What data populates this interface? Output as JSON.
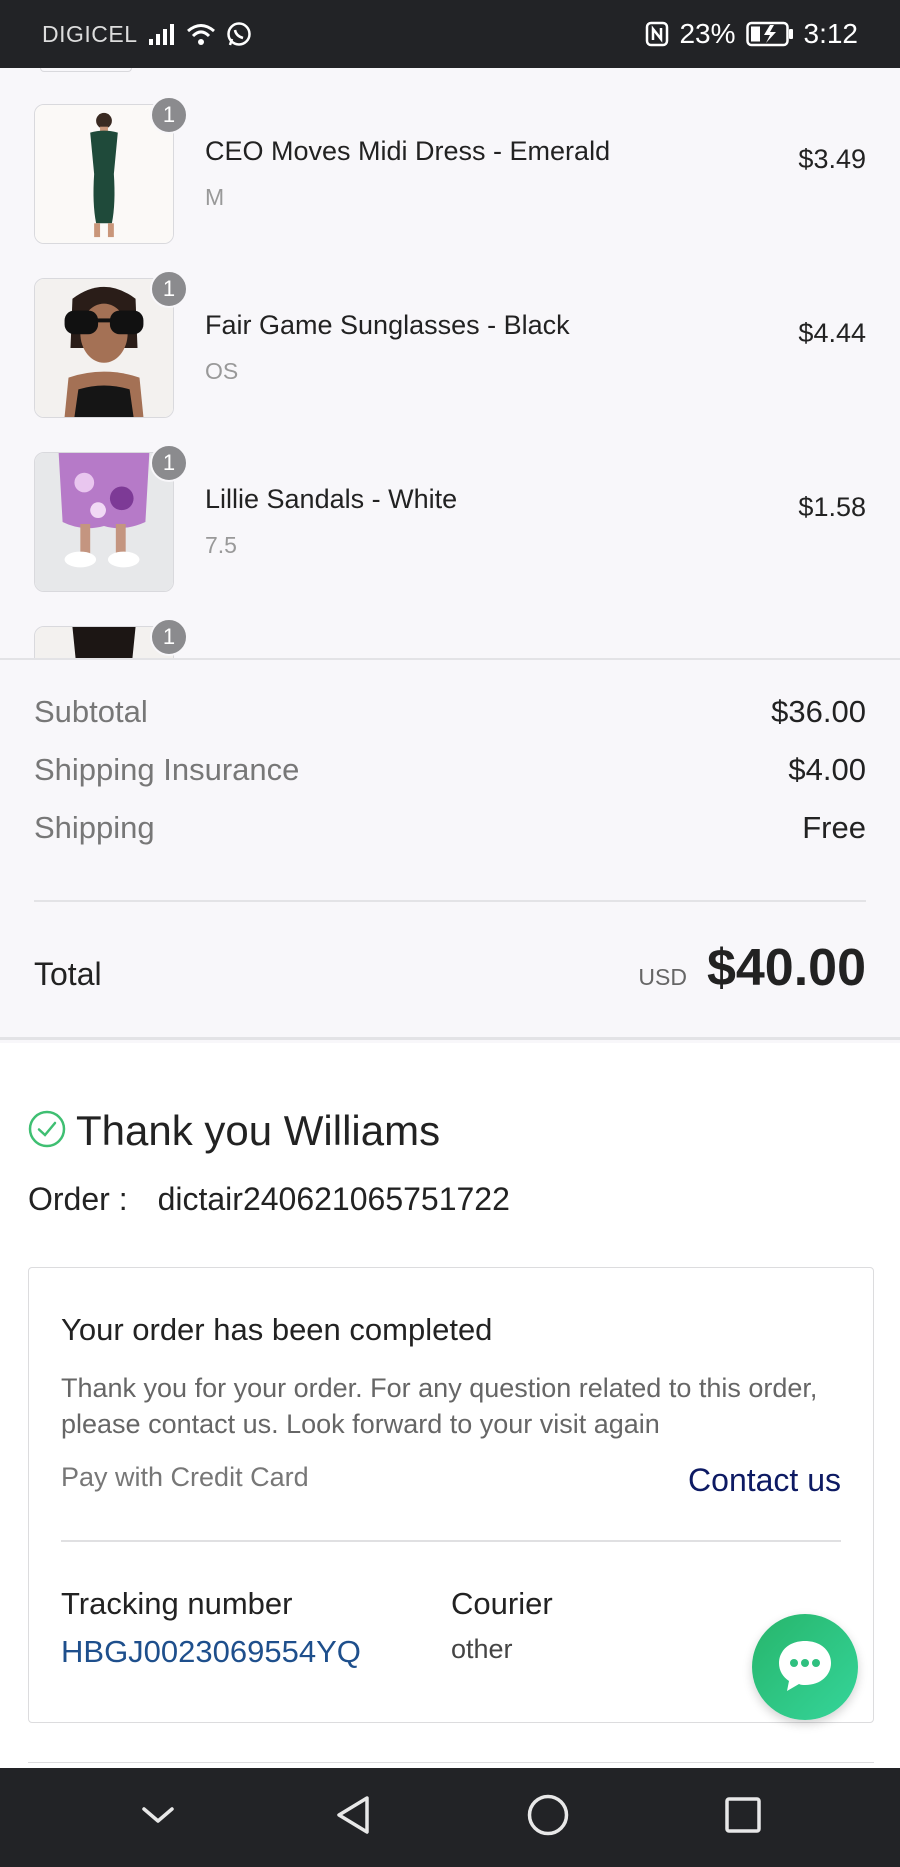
{
  "status_bar": {
    "carrier": "DIGICEL",
    "battery": "23%",
    "time": "3:12"
  },
  "items": [
    {
      "name": "CEO Moves Midi Dress - Emerald",
      "variant": "M",
      "price": "$3.49",
      "qty": "1"
    },
    {
      "name": "Fair Game Sunglasses - Black",
      "variant": "OS",
      "price": "$4.44",
      "qty": "1"
    },
    {
      "name": "Lillie Sandals - White",
      "variant": "7.5",
      "price": "$1.58",
      "qty": "1"
    },
    {
      "name": "",
      "variant": "",
      "price": "",
      "qty": "1"
    }
  ],
  "summary": {
    "subtotal_label": "Subtotal",
    "subtotal_value": "$36.00",
    "insurance_label": "Shipping Insurance",
    "insurance_value": "$4.00",
    "shipping_label": "Shipping",
    "shipping_value": "Free",
    "total_label": "Total",
    "currency": "USD",
    "total_value": "$40.00"
  },
  "confirmation": {
    "thanks": "Thank you Williams",
    "order_label": "Order :",
    "order_number": "dictair240621065751722",
    "card_title": "Your order has been completed",
    "card_desc": "Thank you for your order. For any question related to this order, please contact us. Look forward to your visit again",
    "pay_method": "Pay with Credit Card",
    "contact_link": "Contact us",
    "tracking_label": "Tracking number",
    "tracking_value": "HBGJ0023069554YQ",
    "courier_label": "Courier",
    "courier_value": "other"
  },
  "icons": {
    "signal": "signal-icon",
    "wifi": "wifi-icon",
    "whatsapp": "whatsapp-icon",
    "nfc": "nfc-icon",
    "battery": "battery-icon",
    "check": "check-circle-icon",
    "chat": "chat-icon",
    "nav_down": "chevron-down-icon",
    "nav_back": "back-icon",
    "nav_home": "home-icon",
    "nav_recent": "recent-apps-icon"
  },
  "colors": {
    "status_bar_bg": "#222326",
    "accent_green": "#27b56b",
    "link_navy": "#0d1a63",
    "tracking_blue": "#1e4f8c"
  }
}
